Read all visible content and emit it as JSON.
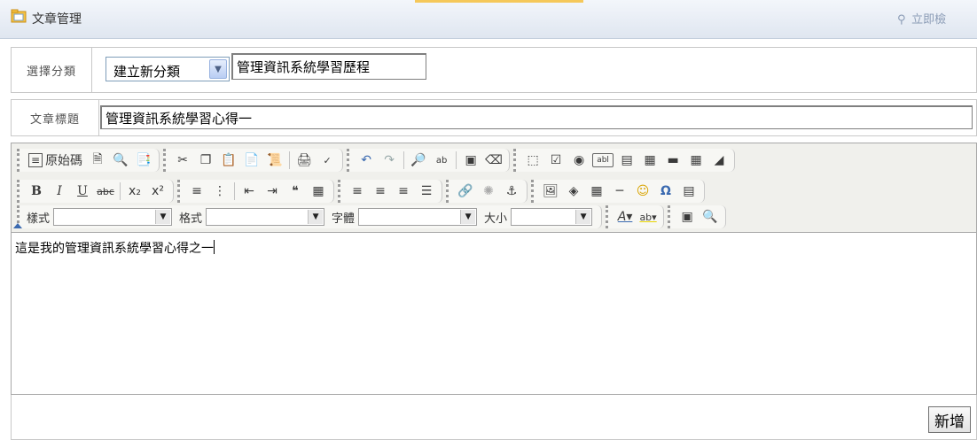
{
  "header": {
    "title": "文章管理",
    "search_label": "立即檢"
  },
  "category": {
    "label": "選擇分類",
    "selected": "建立新分類",
    "new_name": "管理資訊系統學習歷程"
  },
  "article": {
    "label": "文章標題",
    "title": "管理資訊系統學習心得一"
  },
  "toolbar": {
    "source_label": "原始碼",
    "row1_icons": [
      "new-page-icon",
      "preview-icon",
      "templates-icon",
      "cut-icon",
      "copy-icon",
      "paste-icon",
      "paste-text-icon",
      "paste-word-icon",
      "print-icon",
      "spellcheck-icon",
      "undo-icon",
      "redo-icon",
      "find-icon",
      "replace-icon",
      "select-all-icon",
      "remove-format-icon",
      "form-icon",
      "checkbox-icon",
      "radio-icon",
      "textfield-icon",
      "textarea-icon",
      "select-field-icon",
      "button-field-icon",
      "image-button-icon",
      "hidden-field-icon"
    ],
    "style_label": "樣式",
    "format_label": "格式",
    "font_label": "字體",
    "size_label": "大小"
  },
  "editor": {
    "content": "這是我的管理資訊系統學習心得之一"
  },
  "footer": {
    "add_label": "新增"
  },
  "colors": {
    "accent_blue": "#3b6ab0",
    "titlebar_top": "#f3f6fb",
    "titlebar_bottom": "#dfe6f0"
  }
}
